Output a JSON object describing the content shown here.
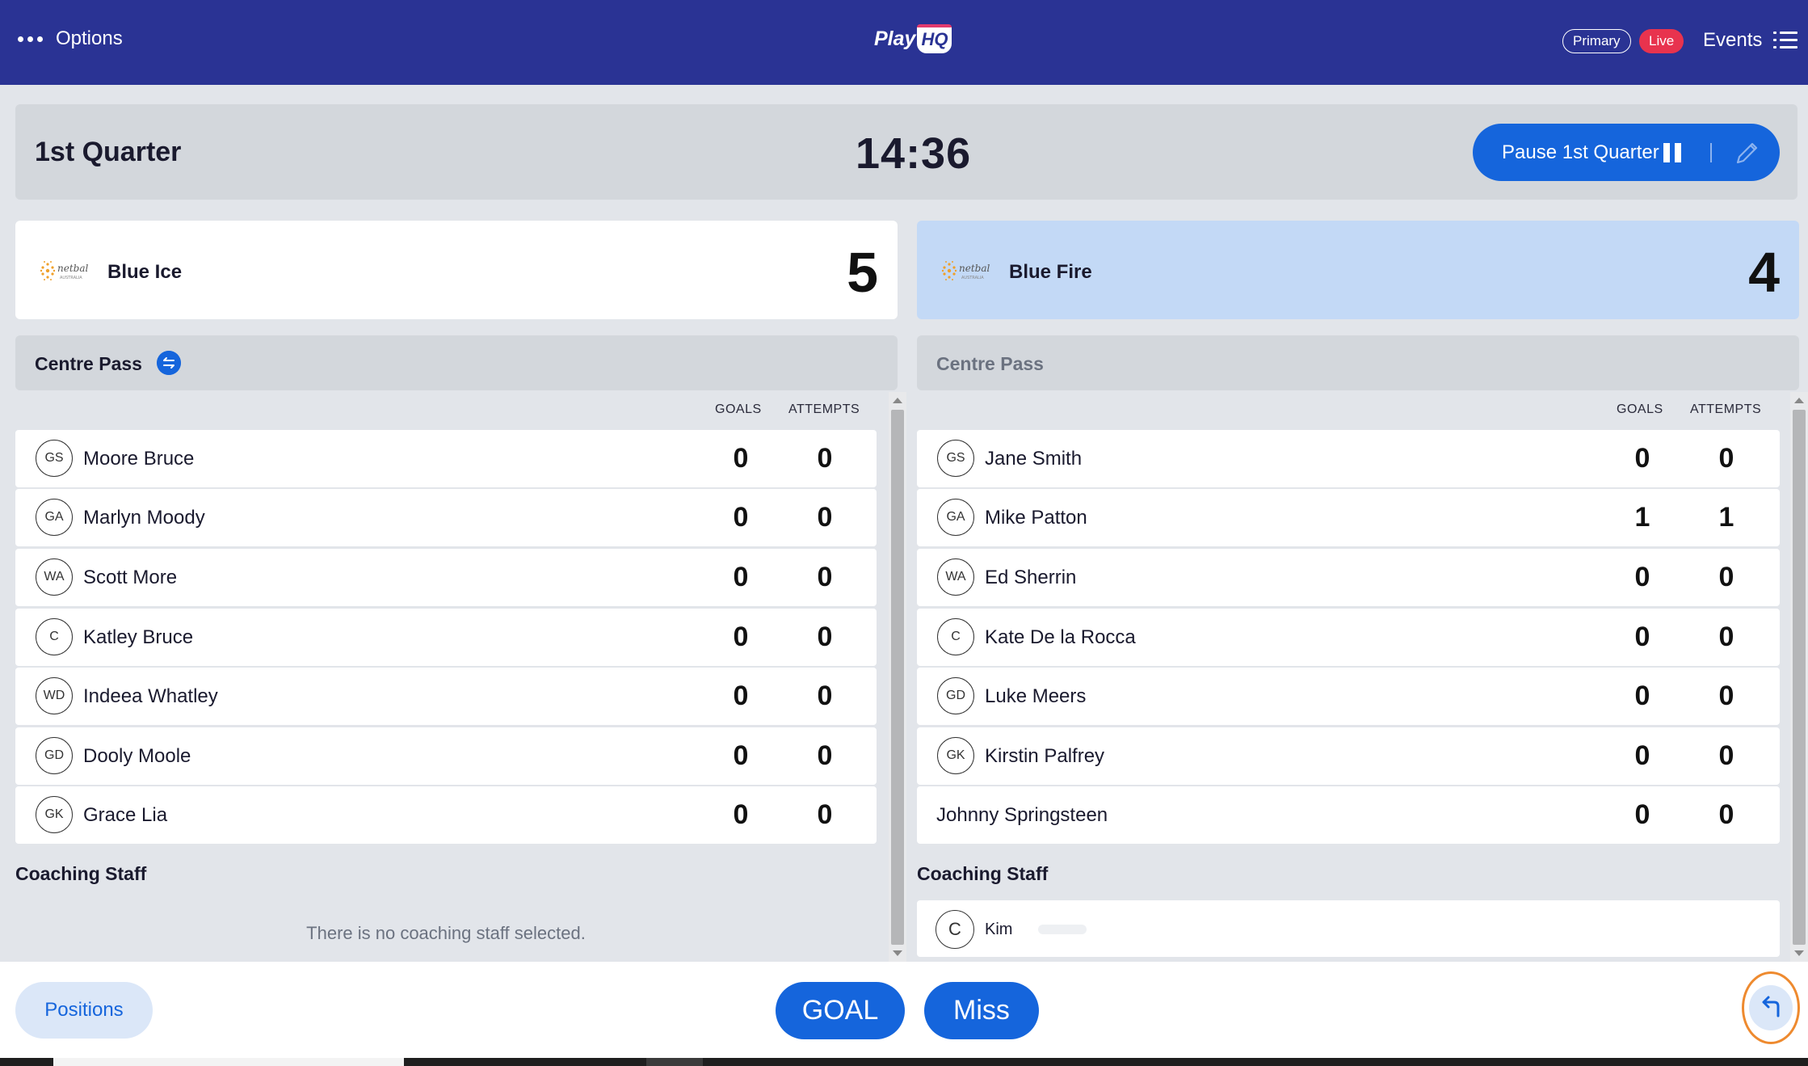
{
  "header": {
    "options_label": "Options",
    "logo_text": "Play",
    "logo_hq": "HQ",
    "primary_label": "Primary",
    "live_label": "Live",
    "events_label": "Events"
  },
  "quarter": {
    "title": "1st Quarter",
    "clock": "14:36",
    "pause_label": "Pause 1st Quarter"
  },
  "teams": {
    "home": {
      "name": "Blue Ice",
      "score": "5",
      "logo": "netball-australia-logo"
    },
    "away": {
      "name": "Blue Fire",
      "score": "4",
      "logo": "netball-australia-logo"
    }
  },
  "centre_pass": {
    "left_label": "Centre Pass",
    "right_label": "Centre Pass"
  },
  "columns": {
    "goals": "GOALS",
    "attempts": "ATTEMPTS"
  },
  "home_players": [
    {
      "pos": "GS",
      "name": "Moore Bruce",
      "goals": "0",
      "attempts": "0"
    },
    {
      "pos": "GA",
      "name": "Marlyn Moody",
      "goals": "0",
      "attempts": "0"
    },
    {
      "pos": "WA",
      "name": "Scott More",
      "goals": "0",
      "attempts": "0"
    },
    {
      "pos": "C",
      "name": "Katley Bruce",
      "goals": "0",
      "attempts": "0"
    },
    {
      "pos": "WD",
      "name": "Indeea Whatley",
      "goals": "0",
      "attempts": "0"
    },
    {
      "pos": "GD",
      "name": "Dooly Moole",
      "goals": "0",
      "attempts": "0"
    },
    {
      "pos": "GK",
      "name": "Grace Lia",
      "goals": "0",
      "attempts": "0"
    }
  ],
  "away_players": [
    {
      "pos": "GS",
      "name": "Jane Smith",
      "goals": "0",
      "attempts": "0"
    },
    {
      "pos": "GA",
      "name": "Mike Patton",
      "goals": "1",
      "attempts": "1"
    },
    {
      "pos": "WA",
      "name": "Ed Sherrin",
      "goals": "0",
      "attempts": "0"
    },
    {
      "pos": "C",
      "name": "Kate De la Rocca",
      "goals": "0",
      "attempts": "0"
    },
    {
      "pos": "GD",
      "name": "Luke Meers",
      "goals": "0",
      "attempts": "0"
    },
    {
      "pos": "GK",
      "name": "Kirstin Palfrey",
      "goals": "0",
      "attempts": "0"
    },
    {
      "pos": "",
      "name": "Johnny Springsteen",
      "goals": "0",
      "attempts": "0"
    }
  ],
  "coaching": {
    "title_left": "Coaching Staff",
    "title_right": "Coaching Staff",
    "empty_message": "There is no coaching staff selected.",
    "away_coach_role": "C",
    "away_coach_name": "Kim"
  },
  "bottom": {
    "positions_label": "Positions",
    "goal_label": "GOAL",
    "miss_label": "Miss"
  },
  "colors": {
    "header_bg": "#2a3394",
    "accent": "#1565dc",
    "live": "#e8334e",
    "away_card_bg": "#c3d9f6",
    "undo_ring": "#ee8a2f"
  }
}
